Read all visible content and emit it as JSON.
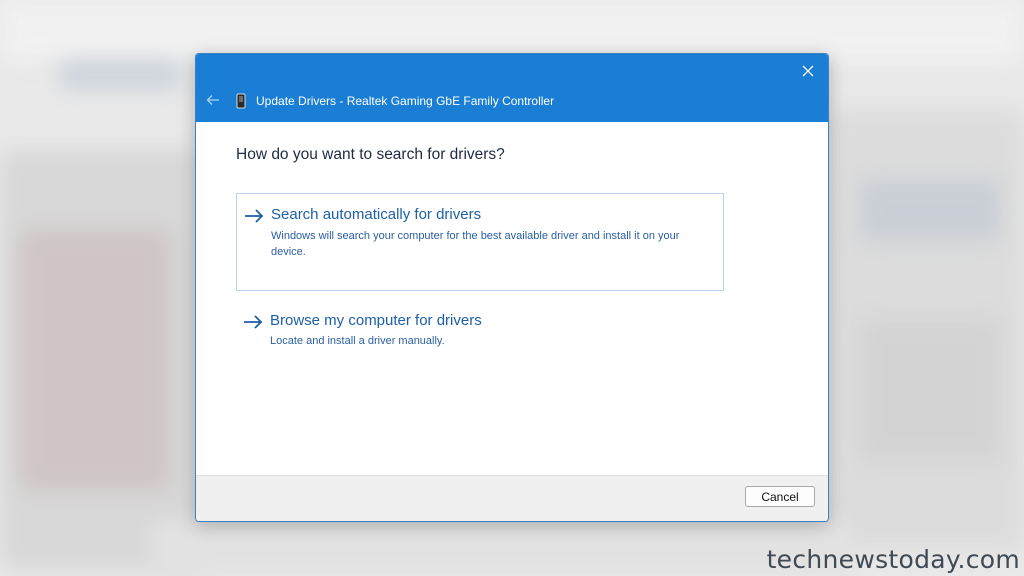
{
  "dialog": {
    "title": "Update Drivers - Realtek Gaming GbE Family Controller",
    "question": "How do you want to search for drivers?",
    "options": [
      {
        "title": "Search automatically for drivers",
        "description": "Windows will search your computer for the best available driver and install it on your device.",
        "icon": "arrow-right-icon"
      },
      {
        "title": "Browse my computer for drivers",
        "description": "Locate and install a driver manually.",
        "icon": "arrow-right-icon"
      }
    ],
    "cancel_label": "Cancel",
    "icons": {
      "close": "close-icon",
      "back": "back-arrow-icon",
      "device": "network-adapter-icon"
    },
    "colors": {
      "titlebar": "#1a7fd4",
      "link": "#1d5fa8"
    }
  },
  "watermark": "technewstoday.com"
}
